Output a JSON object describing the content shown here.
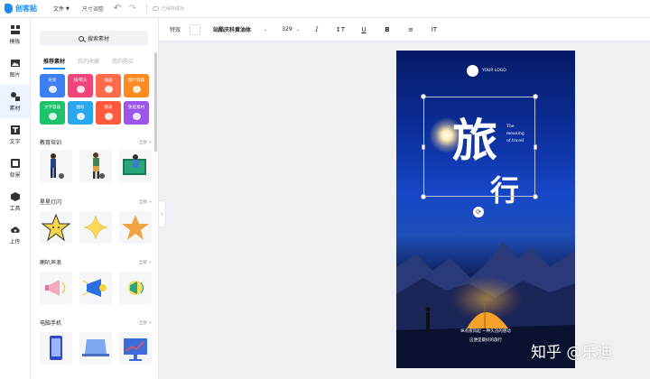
{
  "app": {
    "name": "创客贴"
  },
  "topbar": {
    "file_menu": "文件",
    "resize_menu": "尺寸调整",
    "save_status": "已保存成功"
  },
  "rail": [
    {
      "key": "template",
      "label": "模板",
      "icon": "template-icon"
    },
    {
      "key": "image",
      "label": "图片",
      "icon": "image-icon"
    },
    {
      "key": "material",
      "label": "素材",
      "icon": "material-icon",
      "active": true
    },
    {
      "key": "text",
      "label": "文字",
      "icon": "text-icon"
    },
    {
      "key": "background",
      "label": "背景",
      "icon": "background-icon"
    },
    {
      "key": "tools",
      "label": "工具",
      "icon": "tools-icon"
    },
    {
      "key": "upload",
      "label": "上传",
      "icon": "upload-icon"
    }
  ],
  "panel": {
    "search_label": "搜索素材",
    "tabs": [
      {
        "label": "推荐素材",
        "active": true
      },
      {
        "label": "我的收藏",
        "active": false
      },
      {
        "label": "我的购买",
        "active": false
      }
    ],
    "categories": [
      {
        "label": "形状",
        "color": "#3d7ef5"
      },
      {
        "label": "线/箭头",
        "color": "#f0457a"
      },
      {
        "label": "插画",
        "color": "#ff6b4a"
      },
      {
        "label": "图片容器",
        "color": "#ff8a1f"
      },
      {
        "label": "文字容器",
        "color": "#1ec26a"
      },
      {
        "label": "图标",
        "color": "#29a8f0"
      },
      {
        "label": "图表",
        "color": "#ff5a3c"
      },
      {
        "label": "免抠素材",
        "color": "#9b55e8"
      }
    ],
    "sections": [
      {
        "title": "教育培训",
        "more": "全部 >"
      },
      {
        "title": "星星灯闪",
        "more": "全部 >"
      },
      {
        "title": "喇叭声浪",
        "more": "全部 >"
      },
      {
        "title": "电脑手机",
        "more": "全部 >"
      }
    ]
  },
  "toolbar": {
    "effect_label": "特效",
    "font_name": "站酷庆科黄油体",
    "font_size": "329",
    "italic": "I",
    "line_height": "↕T",
    "underline": "U",
    "bold": "B",
    "align": "≡",
    "letter_spacing": "IT"
  },
  "poster": {
    "logo_text": "YOUR LOGO",
    "title_char_1": "旅",
    "title_char_2": "行",
    "subtitle_lines": [
      "The",
      "meaning",
      "of travel"
    ],
    "caption_line_1": "纵有疾风起 一种久违的感动",
    "caption_line_2": "这便是最好的旅行"
  },
  "watermark": "知乎 @乐迪"
}
